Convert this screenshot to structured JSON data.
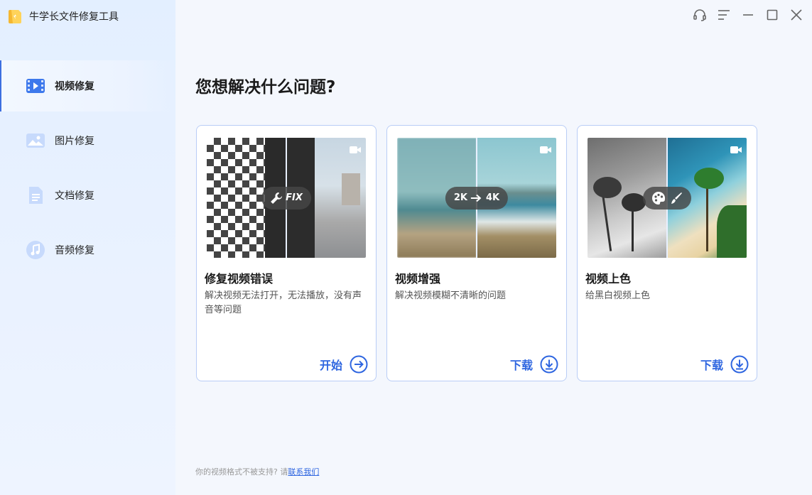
{
  "app": {
    "title": "牛学长文件修复工具"
  },
  "window_controls": [
    "support-icon",
    "menu-icon",
    "minimize-icon",
    "maximize-icon",
    "close-icon"
  ],
  "sidebar": {
    "items": [
      {
        "label": "视频修复",
        "icon": "video-repair-icon",
        "active": true
      },
      {
        "label": "图片修复",
        "icon": "image-repair-icon",
        "active": false
      },
      {
        "label": "文档修复",
        "icon": "document-repair-icon",
        "active": false
      },
      {
        "label": "音频修复",
        "icon": "audio-repair-icon",
        "active": false
      }
    ]
  },
  "main": {
    "title": "您想解决什么问题?",
    "cards": [
      {
        "title": "修复视频错误",
        "description": "解决视频无法打开，无法播放，没有声音等问题",
        "badge": "FIX",
        "action": "开始",
        "action_icon": "arrow-right-circle-icon"
      },
      {
        "title": "视频增强",
        "description": "解决视频模糊不清晰的问题",
        "badge_from": "2K",
        "badge_to": "4K",
        "action": "下载",
        "action_icon": "download-circle-icon"
      },
      {
        "title": "视频上色",
        "description": "给黑白视频上色",
        "badge": "palette-brush",
        "action": "下载",
        "action_icon": "download-circle-icon"
      }
    ]
  },
  "footer": {
    "text": "你的视频格式不被支持? 请",
    "link": "联系我们"
  },
  "colors": {
    "accent": "#2f66e0",
    "sidebar_bg": "#e3efff",
    "card_border": "#b9cdf6"
  }
}
